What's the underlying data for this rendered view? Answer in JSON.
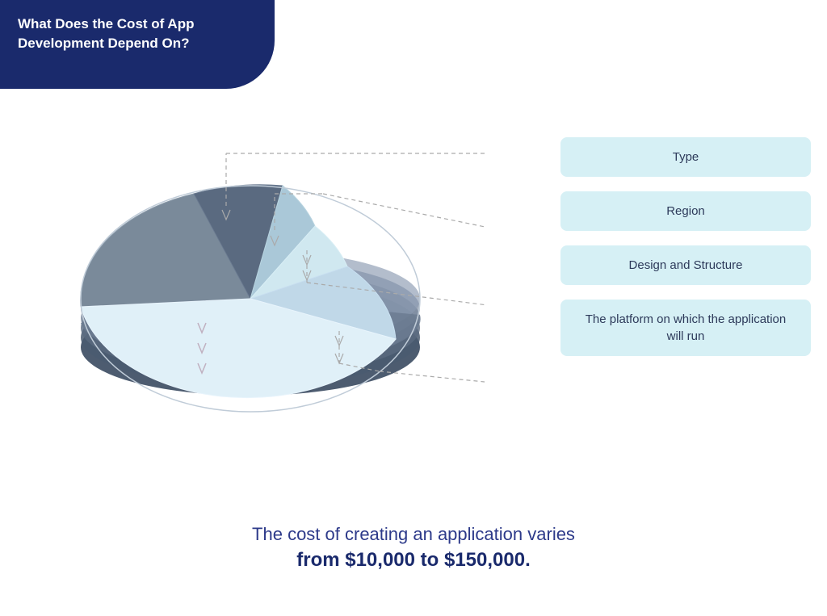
{
  "header": {
    "title": "What Does the Cost of App Development Depend On?"
  },
  "legend": {
    "items": [
      {
        "id": "type",
        "label": "Type"
      },
      {
        "id": "region",
        "label": "Region"
      },
      {
        "id": "design",
        "label": "Design and Structure"
      },
      {
        "id": "platform",
        "label": "The platform on which the application will run"
      }
    ]
  },
  "footer": {
    "line1": "The cost of creating an application varies",
    "line2": "from $10,000 to $150,000."
  },
  "colors": {
    "dark_navy": "#1a2a6c",
    "medium_blue": "#2d3a8a",
    "light_cyan": "#d6f0f5",
    "pie_light_blue": "#b8dde8",
    "pie_medium_gray": "#8a9ab5",
    "pie_dark_gray": "#5a6a80",
    "pie_darkest": "#3a4a60",
    "pie_silver": "#c8d4e0",
    "pie_white_blue": "#e8f4f8"
  }
}
